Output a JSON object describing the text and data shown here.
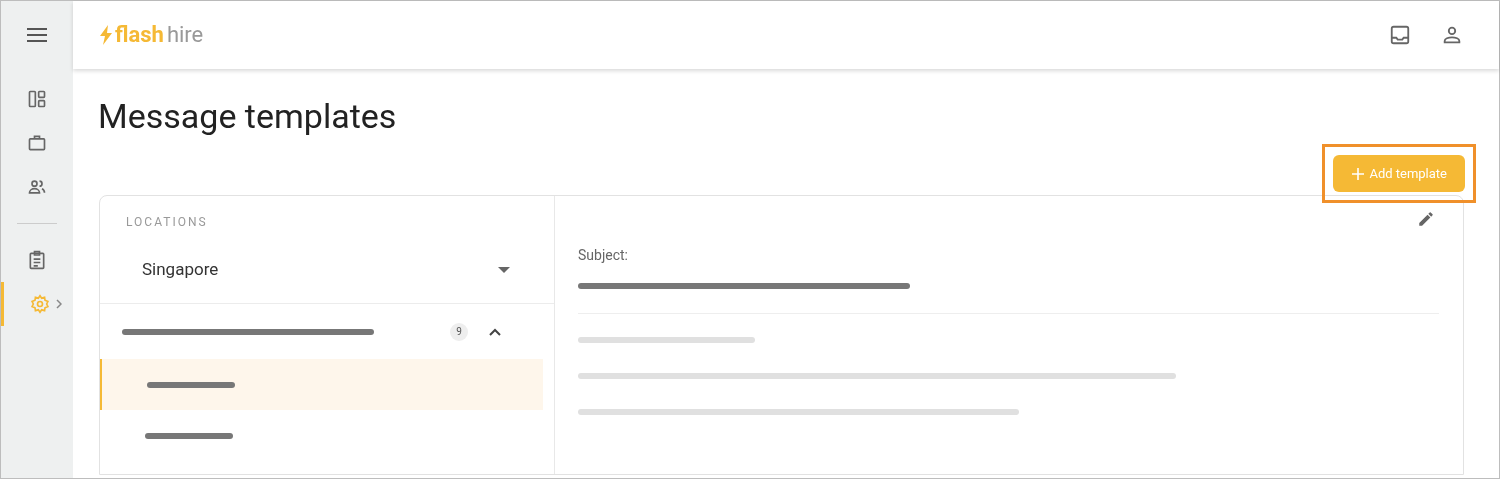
{
  "sidebar": {
    "items": [
      {
        "kind": "dashboard",
        "selected": false
      },
      {
        "kind": "briefcase",
        "selected": false
      },
      {
        "kind": "people",
        "selected": false
      },
      {
        "kind": "divider"
      },
      {
        "kind": "clipboard",
        "selected": false
      },
      {
        "kind": "settings",
        "selected": true
      }
    ]
  },
  "header": {
    "logo_bold": "flash",
    "logo_light": "hire"
  },
  "page": {
    "title": "Message templates",
    "add_button": "Add template",
    "highlighted": true
  },
  "locations": {
    "heading": "LOCATIONS",
    "selected_location": "Singapore",
    "groups": [
      {
        "count": "9",
        "expanded": true,
        "children": [
          {
            "selected": true
          },
          {
            "selected": false
          }
        ]
      }
    ]
  },
  "detail": {
    "subject_label": "Subject:"
  }
}
